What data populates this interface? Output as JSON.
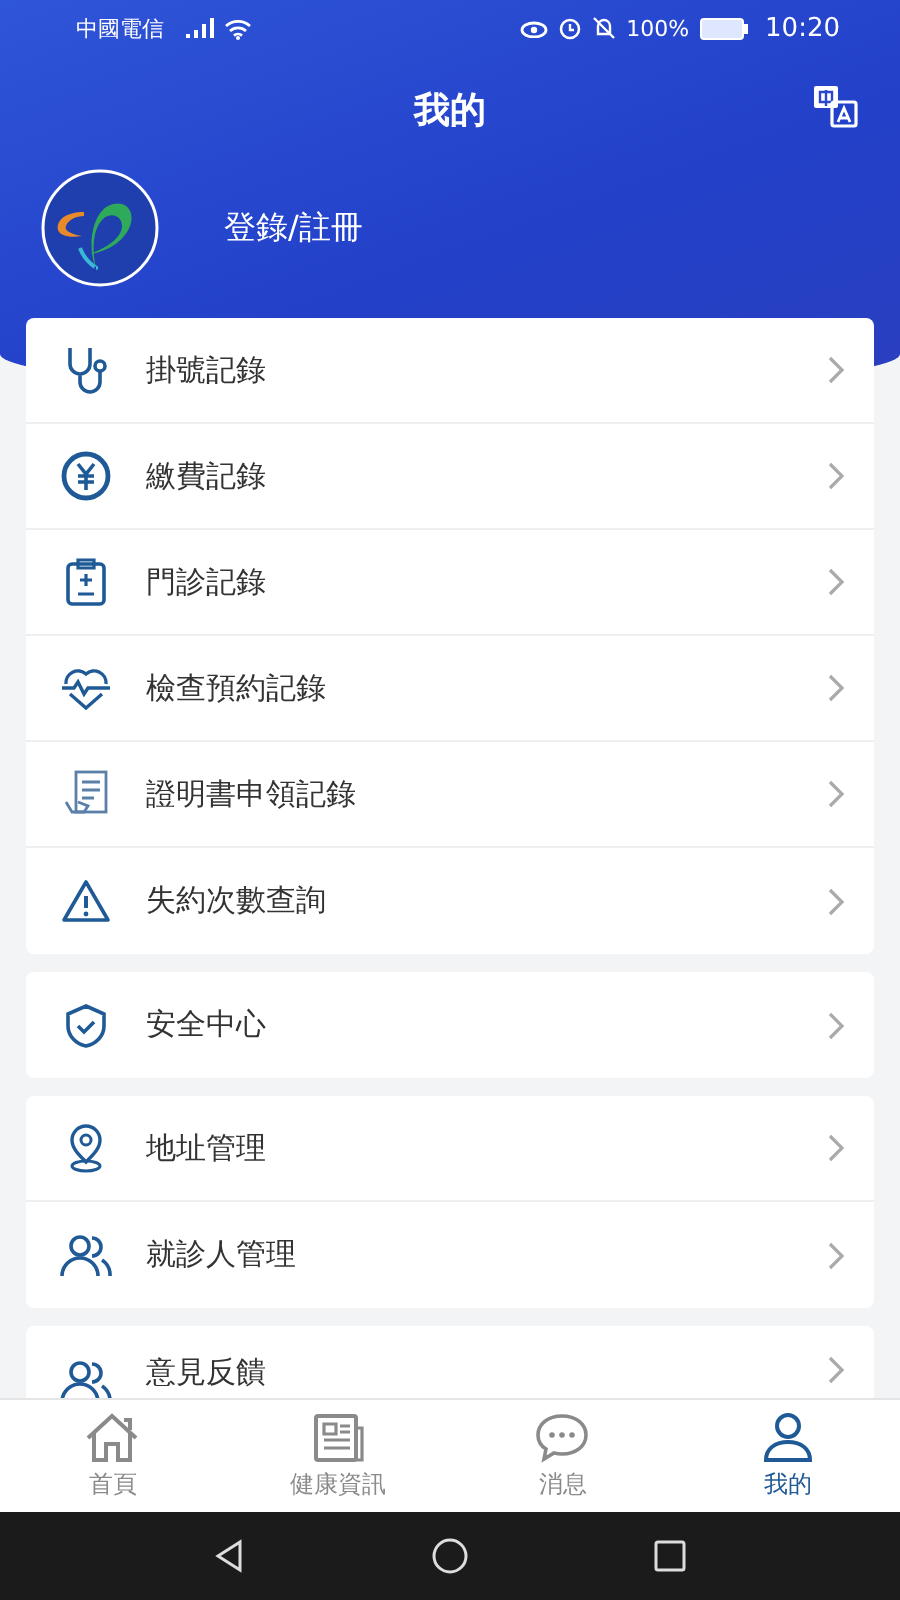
{
  "status_bar": {
    "carrier": "中國電信",
    "battery": "100%",
    "time": "10:20"
  },
  "header": {
    "title": "我的",
    "login": "登錄/註冊"
  },
  "groups": [
    {
      "items": [
        {
          "label": "掛號記錄",
          "kind": "stethoscope"
        },
        {
          "label": "繳費記錄",
          "kind": "yen"
        },
        {
          "label": "門診記錄",
          "kind": "clipboard"
        },
        {
          "label": "檢查預約記錄",
          "kind": "heart"
        },
        {
          "label": "證明書申領記錄",
          "kind": "document"
        },
        {
          "label": "失約次數查詢",
          "kind": "warning"
        }
      ]
    },
    {
      "items": [
        {
          "label": "安全中心",
          "kind": "shield"
        }
      ]
    },
    {
      "items": [
        {
          "label": "地址管理",
          "kind": "pin"
        },
        {
          "label": "就診人管理",
          "kind": "people"
        }
      ]
    },
    {
      "items": [
        {
          "label": "意見反饋",
          "kind": "people"
        }
      ]
    }
  ],
  "tabs": [
    {
      "label": "首頁",
      "kind": "home",
      "selected": false
    },
    {
      "label": "健康資訊",
      "kind": "news",
      "selected": false
    },
    {
      "label": "消息",
      "kind": "chat",
      "selected": false
    },
    {
      "label": "我的",
      "kind": "user",
      "selected": true
    }
  ]
}
